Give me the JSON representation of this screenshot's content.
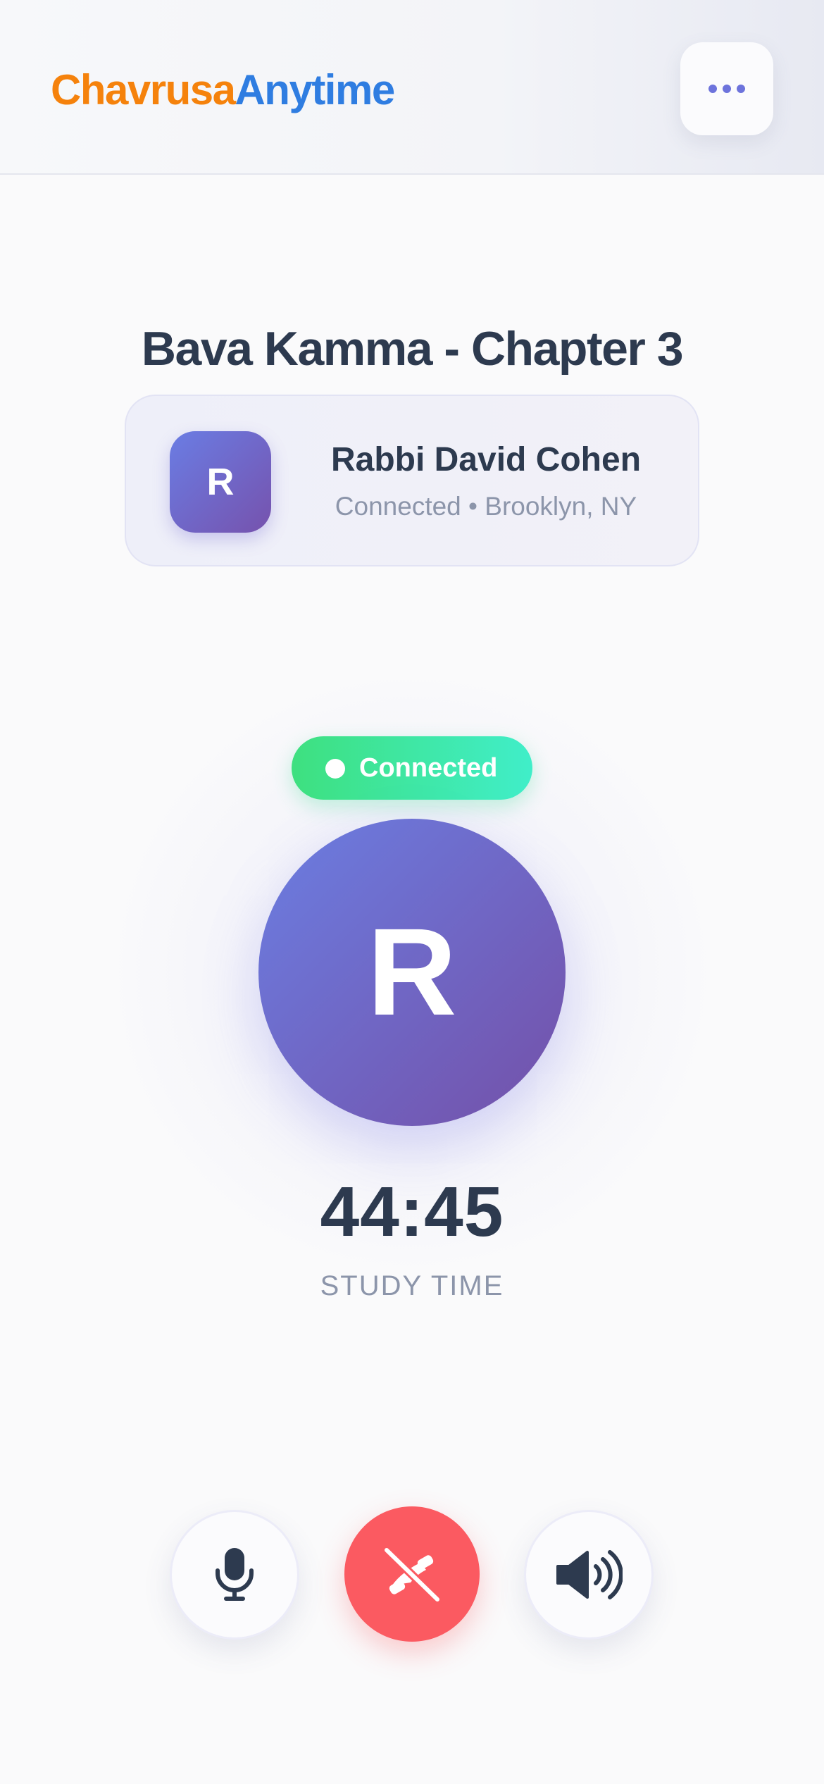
{
  "header": {
    "logo_part1": "Chavrusa",
    "logo_part2": "Anytime",
    "menu_icon": "more-horizontal-icon"
  },
  "session": {
    "title": "Bava Kamma - Chapter 3"
  },
  "partner": {
    "initial": "R",
    "name": "Rabbi David Cohen",
    "status": "Connected • Brooklyn, NY"
  },
  "call": {
    "badge_label": "Connected",
    "avatar_initial": "R",
    "timer": "44:45",
    "timer_label": "STUDY TIME"
  },
  "controls": {
    "mute_icon": "microphone-icon",
    "end_icon": "end-call-icon",
    "speaker_icon": "speaker-icon"
  },
  "colors": {
    "logo_orange": "#f5820c",
    "logo_blue": "#2f7de1",
    "text_dark": "#2d3a4f",
    "text_muted": "#8c95aa",
    "avatar_gradient_start": "#6a7de4",
    "avatar_gradient_end": "#7652ad",
    "connected_green": "#3ee07f",
    "end_call_red": "#fb5a61"
  }
}
